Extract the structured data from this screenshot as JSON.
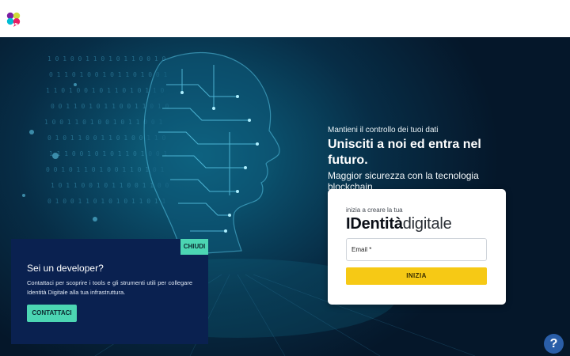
{
  "header": {
    "logo_icon": "four-petal-logo-icon",
    "logo_colors": [
      "#e91e63",
      "#7b1fa2",
      "#00bcd4",
      "#cddc39"
    ]
  },
  "hero": {
    "kicker": "Mantieni il controllo dei tuoi dati",
    "headline": "Unisciti a noi ed entra nel futuro.",
    "subline": "Maggior sicurezza con la tecnologia blockchain"
  },
  "signup": {
    "kicker": "inizia a creare la tua",
    "brand_bold": "IDentità",
    "brand_light": "digitale",
    "email_label": "Email *",
    "button": "INIZIA",
    "button_color": "#f6c915"
  },
  "developer": {
    "close": "CHIUDI",
    "title": "Sei un developer?",
    "text": "Contattaci per scoprire i tools e gli strumenti utili per collegare Identità Digitale alla tua infrastruttura.",
    "button": "CONTATTACI",
    "accent_color": "#4cd6b3"
  },
  "help": {
    "label": "?",
    "icon": "help-icon"
  }
}
